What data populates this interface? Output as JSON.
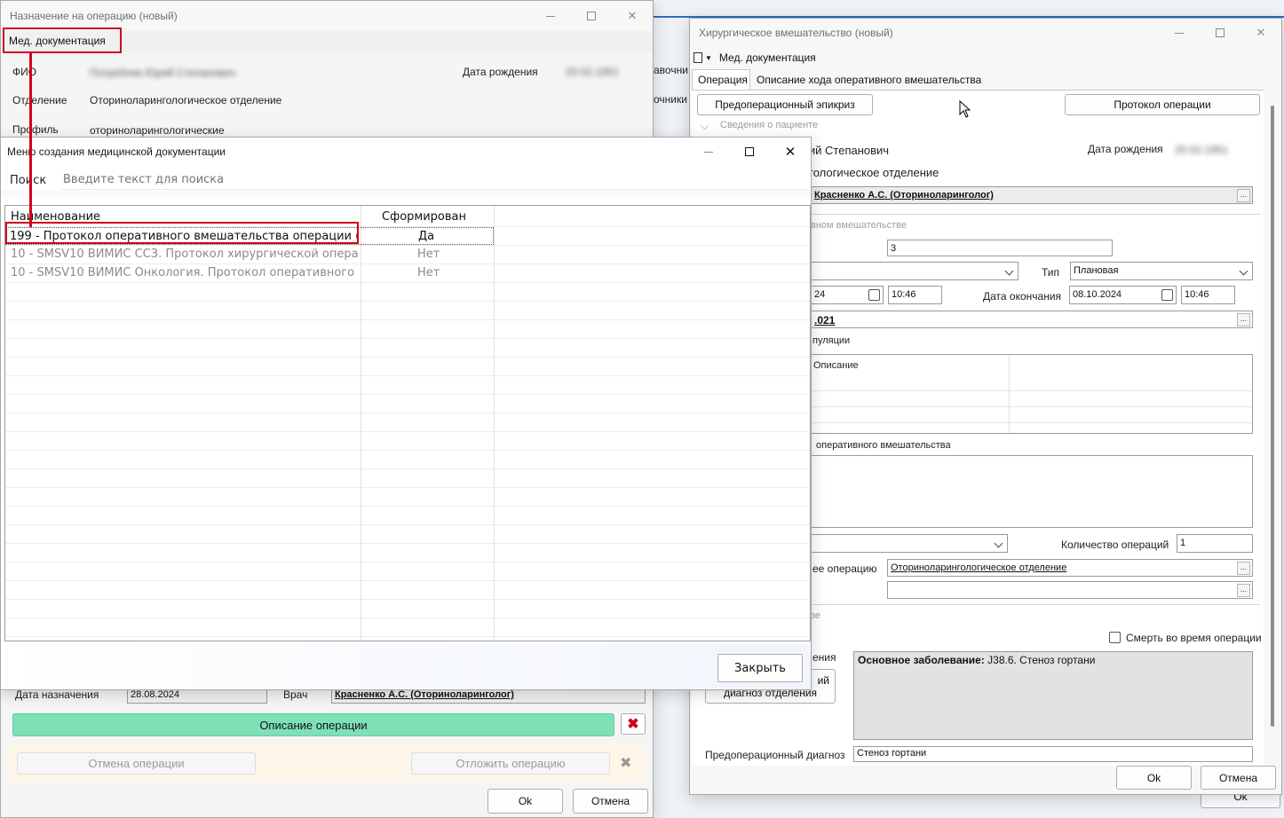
{
  "win1": {
    "title": "Назначение на операцию (новый)",
    "menu_med_docs": "Мед. документация",
    "fio_label": "ФИО",
    "fio_value": "Потребняк Юрий Степанович",
    "birth_label": "Дата рождения",
    "birth_value": "20.02.1951",
    "dept_label": "Отделение",
    "dept_value": "Оториноларингологическое отделение",
    "profile_label": "Профиль",
    "profile_value": "оториноларингологические",
    "date_label": "Дата назначения",
    "date_value": "28.08.2024",
    "doctor_label": "Врач",
    "doctor_value": "Красненко А.С. (Оториноларинголог)",
    "describe_btn": "Описание операции",
    "cancel_op_btn": "Отмена операции",
    "postpone_btn": "Отложить операцию",
    "ok_btn": "Ok",
    "cancel_btn": "Отмена"
  },
  "bg_fragments": {
    "frag1": "авочни",
    "frag2": "очники"
  },
  "win2": {
    "title": "Хирургическое вмешательство (новый)",
    "menu_med_docs": "Мед. документация",
    "tabs": [
      "Операция",
      "Описание хода оперативного вмешательства"
    ],
    "preop_btn": "Предоперационный эпикриз",
    "protocol_btn": "Протокол операции",
    "section_patient": "Сведения о пациенте",
    "patient_name": "Потребняк Юрий Степанович",
    "birth_label": "Дата рождения",
    "birth_value": "20.02.1951",
    "dept_value": "Оториноларингологическое отделение",
    "doctor_value": "Красненко А.С. (Оториноларинголог)",
    "section_op": "Сведения об оперативном вмешательстве",
    "number_value": "3",
    "type_label": "Тип",
    "type_value": "Плановая",
    "start_date": "08.10.2024",
    "start_time": "10:46",
    "end_label": "Дата окончания",
    "end_date": "08.10.2024",
    "end_time": "10:46",
    "op_code": ".021",
    "manip_label": "пуляции",
    "desc_col": "Описание",
    "op_desc_label": "оперативного вмешательства",
    "qty_label": "Количество операций",
    "qty_value": "1",
    "performing_label": "ее операцию",
    "performing_value": "Оториноларингологическое отделение",
    "section_other": "зе",
    "death_label": "Смерть во время операции",
    "diag_label_frag": "ения",
    "diag_btn_frag1": "ий",
    "diag_btn_frag2": "диагноз отделения",
    "main_diag_bold": "Основное заболевание:",
    "main_diag_text": " J38.6. Стеноз гортани",
    "preop_diag_label": "Предоперационный диагноз",
    "preop_diag_value": "Стеноз гортани",
    "ok_btn": "Ok",
    "cancel_btn": "Отмена",
    "bg_ok": "Ok"
  },
  "win3": {
    "title": "Меню создания медицинской документации",
    "search_label": "Поиск",
    "search_placeholder": "Введите текст для поиска",
    "col_name": "Наименование",
    "col_formed": "Сформирован",
    "rows": [
      {
        "name": "199 - Протокол оперативного вмешательства операции (...",
        "formed": "Да"
      },
      {
        "name": "10 - SMSV10 ВИМИС ССЗ. Протокол хирургической опера...",
        "formed": "Нет"
      },
      {
        "name": "10 - SMSV10 ВИМИС Онкология. Протокол оперативного в...",
        "formed": "Нет"
      }
    ],
    "close_btn": "Закрыть"
  }
}
